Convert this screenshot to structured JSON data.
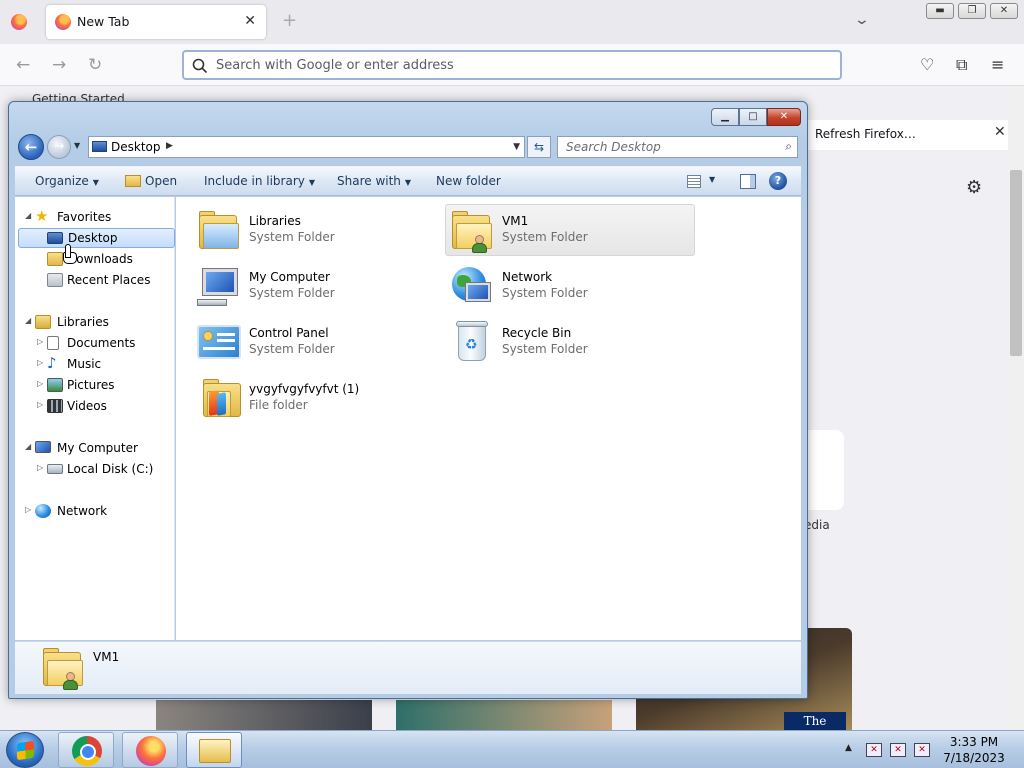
{
  "firefox": {
    "tab_title": "New Tab",
    "new_tab_glyph": "+",
    "url_placeholder": "Search with Google or enter address",
    "bookmark_partial": "Getting Started",
    "notification": "Refresh Firefox…",
    "shortcut_label_partial": "edia",
    "story_badge": "The Guardian"
  },
  "explorer": {
    "address": "Desktop",
    "search_placeholder": "Search Desktop",
    "toolbar": {
      "organize": "Organize",
      "open": "Open",
      "include_in_library": "Include in library",
      "share_with": "Share with",
      "new_folder": "New folder"
    },
    "nav": {
      "favorites": "Favorites",
      "desktop": "Desktop",
      "downloads": "Downloads",
      "recent_places": "Recent Places",
      "libraries": "Libraries",
      "documents": "Documents",
      "music": "Music",
      "pictures": "Pictures",
      "videos": "Videos",
      "my_computer": "My Computer",
      "local_disk": "Local Disk (C:)",
      "network": "Network"
    },
    "items": [
      {
        "name": "Libraries",
        "type": "System Folder"
      },
      {
        "name": "VM1",
        "type": "System Folder"
      },
      {
        "name": "My Computer",
        "type": "System Folder"
      },
      {
        "name": "Network",
        "type": "System Folder"
      },
      {
        "name": "Control Panel",
        "type": "System Folder"
      },
      {
        "name": "Recycle Bin",
        "type": "System Folder"
      },
      {
        "name": "yvgyfvgyfvyfvt (1)",
        "type": "File folder"
      }
    ],
    "selected_item": "VM1",
    "details_name": "VM1"
  },
  "taskbar": {
    "time": "3:33 PM",
    "date": "7/18/2023"
  },
  "colors": {
    "explorer_frame": "#b4cce6",
    "selection": "#c4ddfb",
    "firefox_bg": "#f0f0f4"
  }
}
